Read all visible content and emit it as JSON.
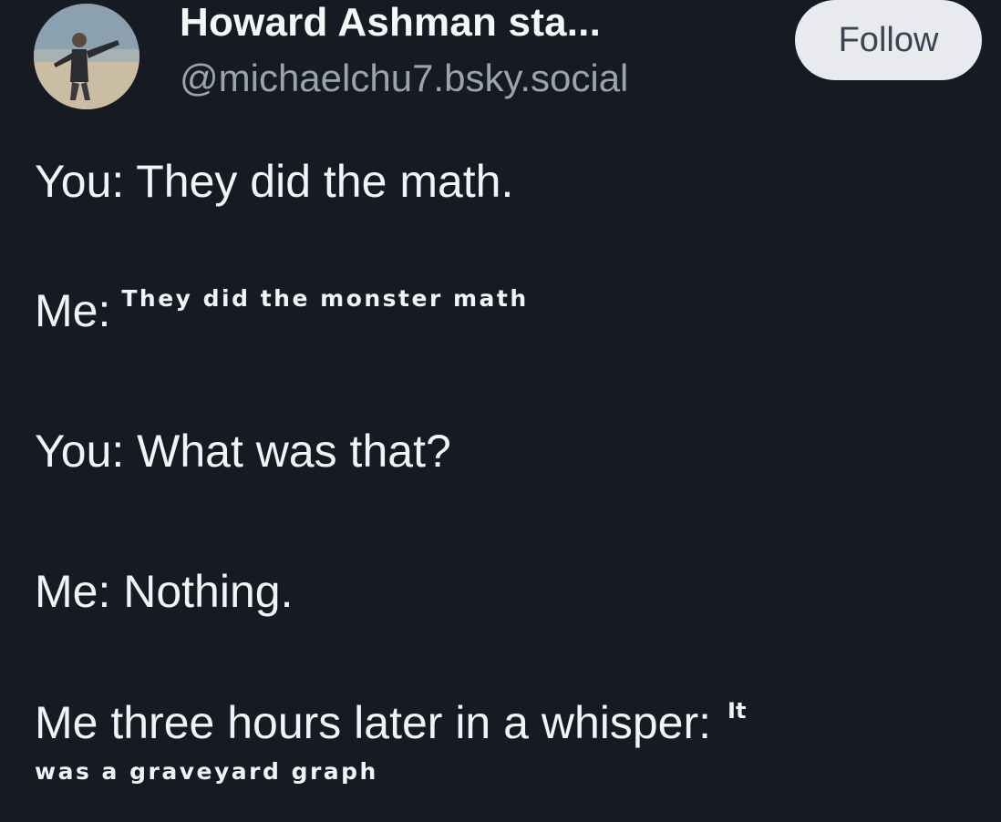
{
  "author": {
    "display_name": "Howard Ashman sta...",
    "handle": "@michaelchu7.bsky.social",
    "avatar_icon": "profile-photo-person-on-beach"
  },
  "follow_button": {
    "label": "Follow"
  },
  "post": {
    "line_1": "You: They did the math.",
    "line_2_prefix": "Me:",
    "line_2_small": "They did the monster math",
    "line_3": "You: What was that?",
    "line_4": "Me: Nothing.",
    "line_5_prefix": "Me three hours later in a whisper:",
    "line_5_tiny": "It",
    "line_6_small": "was a graveyard graph"
  },
  "colors": {
    "background": "#161a22",
    "text": "#f1f3f6",
    "handle": "#9aa3b0",
    "follow_bg": "#e8eaee",
    "follow_text": "#3b4552"
  }
}
